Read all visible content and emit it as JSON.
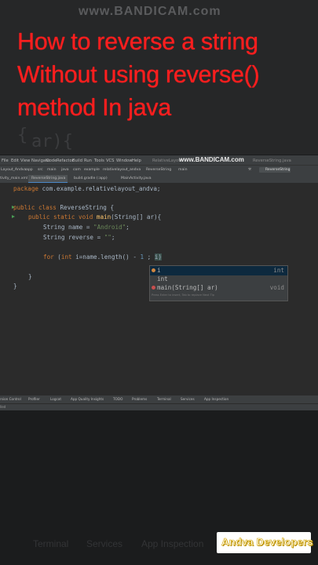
{
  "video": {
    "watermark": "www.BANDICAM.com",
    "title_lines": [
      "How to reverse a string",
      "Without using reverse()",
      "method In java"
    ],
    "background_code": [
      "{",
      "ar){"
    ],
    "channel_logo": "Andva Developers",
    "bottom_tools": [
      "Terminal",
      "Services",
      "App Inspection"
    ]
  },
  "ide": {
    "menu": [
      "File",
      "Edit",
      "View",
      "Navigate",
      "Code",
      "Refactor",
      "Build",
      "Run",
      "Tools",
      "VCS",
      "Window",
      "Help"
    ],
    "window_title_prefix": "RelativeLayout",
    "window_title_suffix": "ReverseString.java",
    "bandicam": "www.BANDICAM.com",
    "breadcrumb": [
      "Layout_Andva",
      "app",
      "src",
      "main",
      "java",
      "com",
      "example",
      "relativelayout_andva",
      "ReverseString",
      "main"
    ],
    "run_config": "ReverseString",
    "tabs": [
      "tivity_main.xml",
      "ReverseString.java",
      "build.gradle (:app)",
      "MainActivity.java"
    ],
    "code": {
      "package_kw": "package",
      "package_name": " com.example.relativelayout_andva;",
      "class_mods": "public class",
      "class_name": " ReverseString {",
      "main_mods": "public static void",
      "main_name": "main",
      "main_params": "(String[] ar){",
      "name_decl": "String name = ",
      "name_value": "\"Android\"",
      "rev_decl": "String reverse = ",
      "rev_value": "\"\"",
      "for_kw": "for",
      "for_open": " (",
      "int_kw": "int",
      "for_rest_a": " i=name.length() - ",
      "one": "1",
      "for_rest_b": " ; ",
      "typed": "i)",
      "close1": "}",
      "close2": "}",
      "semicolon": ";"
    },
    "autocomplete": {
      "items": [
        {
          "name": "i",
          "type": "int"
        },
        {
          "name": "int",
          "type": ""
        },
        {
          "name": "main(String[] ar)",
          "type": "void"
        }
      ],
      "footer": "Press Enter to insert, Tab to replace  Next Tip"
    },
    "tool_windows": [
      "rsion Control",
      "Profiler",
      "Logcat",
      "App Quality Insights",
      "TODO",
      "Problems",
      "Terminal",
      "Services",
      "App Inspection"
    ],
    "status_text": "lled"
  },
  "colors": {
    "title_red": "#ff1e1e",
    "editor_bg": "#2b2b2b",
    "keyword": "#cc7832",
    "string": "#6a8759",
    "logo_yellow": "#d4a600"
  }
}
